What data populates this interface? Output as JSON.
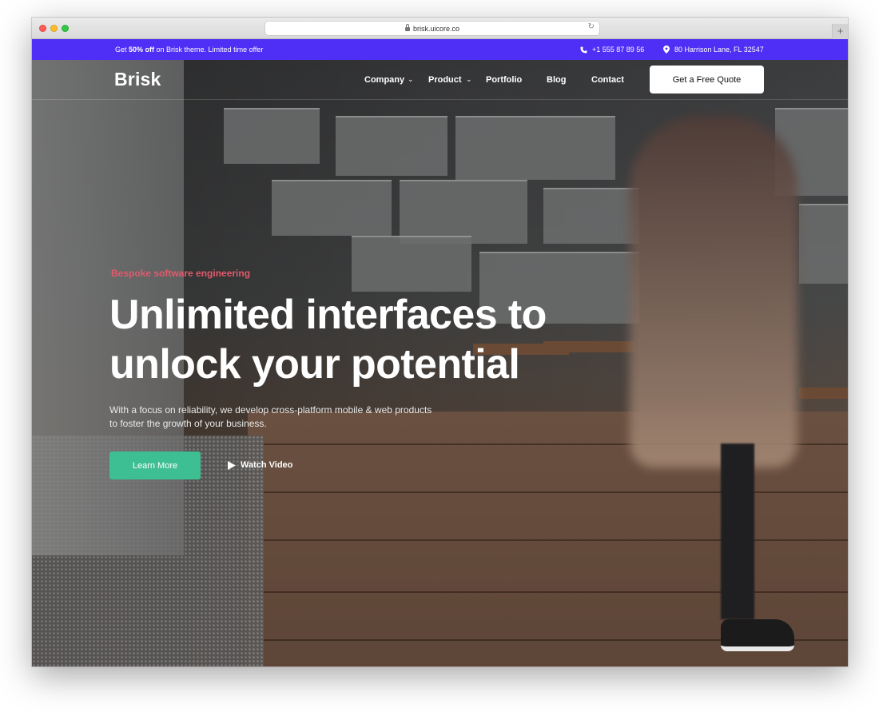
{
  "browser": {
    "url": "brisk.uicore.co",
    "new_tab_symbol": "+"
  },
  "topbar": {
    "promo_prefix": "Get ",
    "promo_bold": "50% off",
    "promo_suffix": " on Brisk theme. Limited time offer",
    "phone": "+1 555 87 89 56",
    "address": "80 Harrison Lane, FL 32547",
    "background_color": "#4f2ef5"
  },
  "nav": {
    "logo": "Brisk",
    "items": [
      {
        "label": "Company",
        "dropdown": true
      },
      {
        "label": "Product",
        "dropdown": true
      },
      {
        "label": "Portfolio",
        "dropdown": false
      },
      {
        "label": "Blog",
        "dropdown": false
      },
      {
        "label": "Contact",
        "dropdown": false
      }
    ],
    "cta_label": "Get a Free Quote"
  },
  "hero": {
    "eyebrow": "Bespoke software engineering",
    "headline_line1": "Unlimited interfaces to",
    "headline_line2": "unlock your potential",
    "subtext_line1": "With a focus on reliability, we develop cross-platform mobile & web products",
    "subtext_line2": "to foster the growth of your business.",
    "primary_button": "Learn More",
    "secondary_button": "Watch Video",
    "accent_color": "#3ebf93",
    "eyebrow_color": "#e15a6c"
  },
  "icons": {
    "phone": "phone-icon",
    "location": "location-pin-icon",
    "play": "play-icon",
    "chevron": "chevron-down-icon"
  }
}
